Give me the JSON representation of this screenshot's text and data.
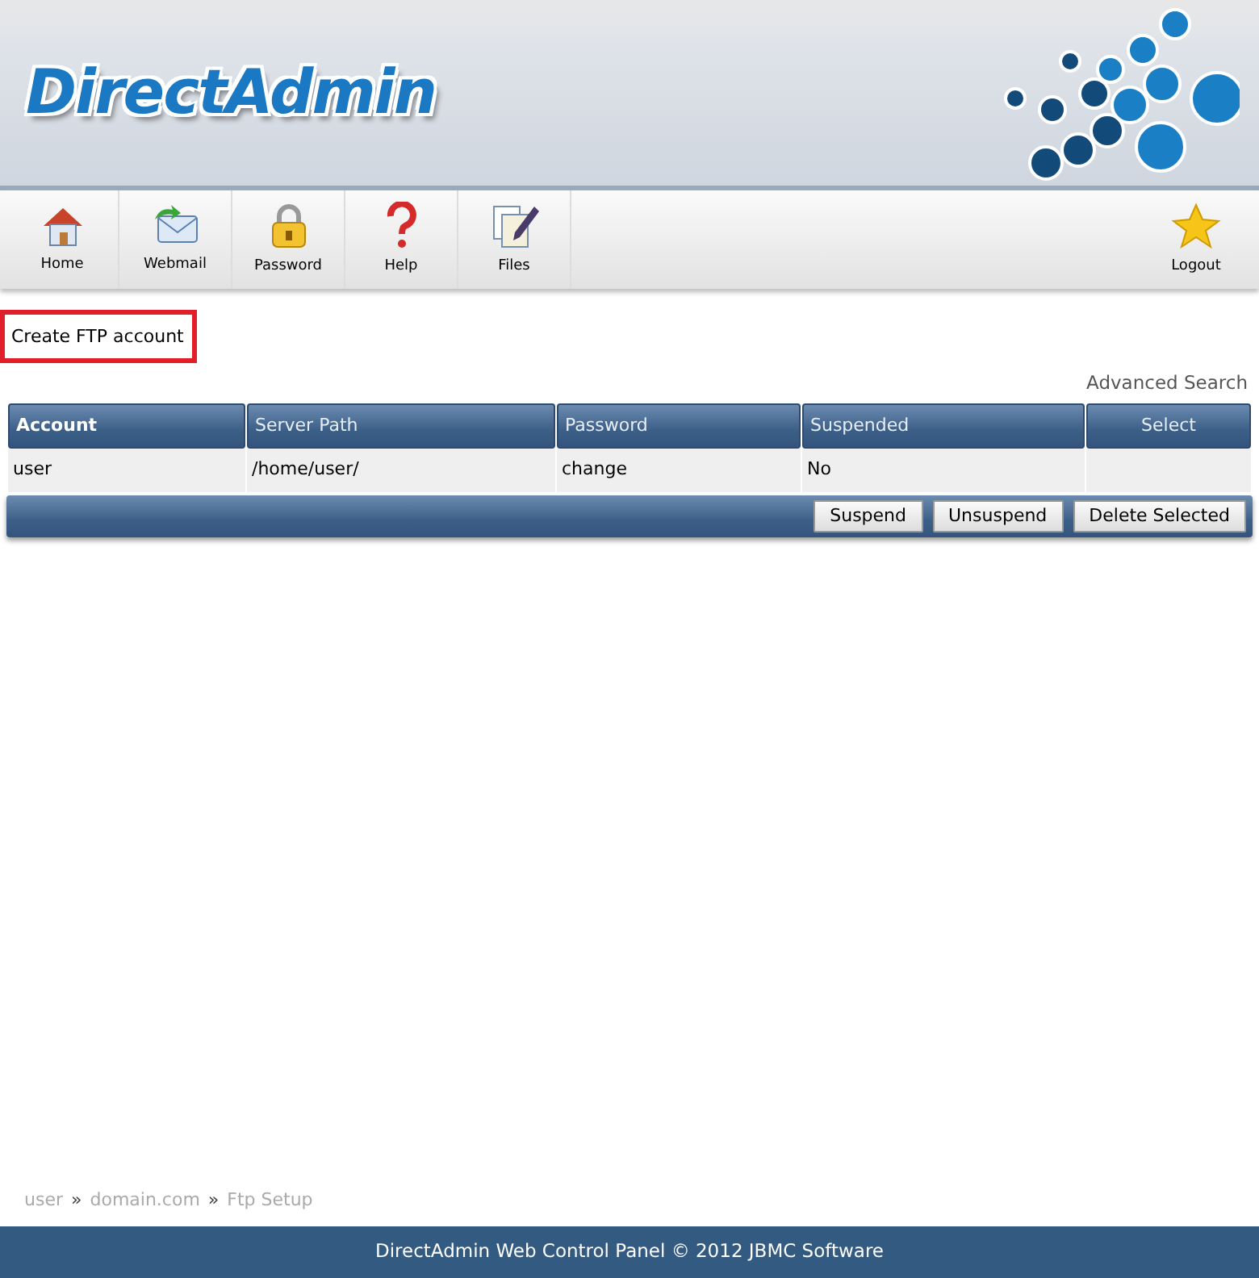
{
  "logo": {
    "text": "DirectAdmin"
  },
  "toolbar": [
    {
      "label": "Home",
      "kind": "home"
    },
    {
      "label": "Webmail",
      "kind": "mail"
    },
    {
      "label": "Password",
      "kind": "lock"
    },
    {
      "label": "Help",
      "kind": "help"
    },
    {
      "label": "Files",
      "kind": "files"
    },
    {
      "label": "Logout",
      "kind": "star"
    }
  ],
  "create_link": {
    "label": "Create FTP account",
    "highlighted": true
  },
  "advanced_search": "Advanced Search",
  "table": {
    "columns": [
      {
        "label": "Account",
        "sorted": true
      },
      {
        "label": "Server Path",
        "sorted": false
      },
      {
        "label": "Password",
        "sorted": false
      },
      {
        "label": "Suspended",
        "sorted": false
      },
      {
        "label": "Select",
        "sorted": false
      }
    ],
    "rows": [
      [
        "user",
        "/home/user/",
        "change",
        "No",
        ""
      ]
    ]
  },
  "actions": [
    "Suspend",
    "Unsuspend",
    "Delete Selected"
  ],
  "breadcrumb": {
    "items": [
      "user",
      "domain.com",
      "Ftp Setup"
    ],
    "separator": "»"
  },
  "footer": "DirectAdmin Web Control Panel © 2012 JBMC Software"
}
